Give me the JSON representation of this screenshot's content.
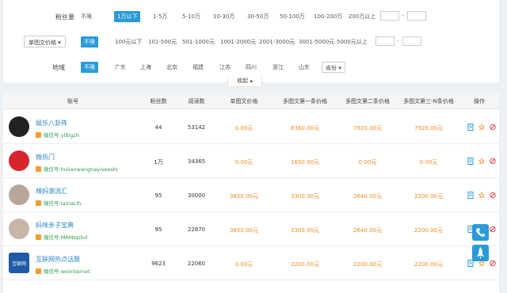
{
  "filters": {
    "fans": {
      "label": "粉丝量",
      "options": [
        "不限",
        "1万以下",
        "1-5万",
        "5-10万",
        "10-30万",
        "30-50万",
        "50-100万",
        "100-200万",
        "200万以上"
      ],
      "active": "1万以下",
      "range_sep": "-"
    },
    "price": {
      "dropdown": "单图文价格",
      "options": [
        "不限",
        "100元以下",
        "101-500元",
        "501-1000元",
        "1001-2000元",
        "2001-3000元",
        "3001-5000元",
        "5000元以上"
      ],
      "active": "不限",
      "range_sep": "-"
    },
    "region": {
      "label": "地域",
      "options": [
        "不限",
        "广东",
        "上海",
        "北京",
        "福建",
        "江苏",
        "四川",
        "浙江",
        "山东"
      ],
      "active": "不限",
      "more": "省份"
    },
    "collapse_label": "收起"
  },
  "table": {
    "headers": [
      "账号",
      "粉丝数",
      "阅读数",
      "单图文价格",
      "多图文第一条价格",
      "多图文第二条价格",
      "多图文第三-N条价格",
      "操作"
    ],
    "wechat_prefix": "微信号:",
    "rows": [
      {
        "name": "娱乐八卦阵",
        "wechat": "yllbgzh",
        "fans": "44",
        "reads": "53142",
        "single": "0.00元",
        "multi1": "8360.00元",
        "multi2": "7920.00元",
        "multi3": "7920.00元",
        "avatar_color": "#222"
      },
      {
        "name": "微热门",
        "wechat": "hulianwangnayiseeshi",
        "fans": "1万",
        "reads": "34365",
        "single": "0.00元",
        "multi1": "1650.00元",
        "multi2": "0.00元",
        "multi3": "0.00元",
        "avatar_color": "#d8242c"
      },
      {
        "name": "辣妈潮流汇",
        "wechat": "lamaclh",
        "fans": "95",
        "reads": "30000",
        "single": "3850.00元",
        "multi1": "3300.00元",
        "multi2": "2640.00元",
        "multi3": "2200.00元",
        "avatar_color": "#b9a69a"
      },
      {
        "name": "妈咪亲子宝典",
        "wechat": "MAMIqzbd",
        "fans": "95",
        "reads": "22870",
        "single": "3850.00元",
        "multi1": "3300.00元",
        "multi2": "2640.00元",
        "multi3": "2200.00元",
        "avatar_color": "#c9b5a8"
      },
      {
        "name": "互联网热点话题",
        "wechat": "woiinternet",
        "fans": "9623",
        "reads": "22060",
        "single": "0.00元",
        "multi1": "2200.00元",
        "multi2": "2200.00元",
        "multi3": "2200.00元",
        "avatar_color": "#1f5aa6",
        "avatar_text": "互联网"
      }
    ]
  }
}
